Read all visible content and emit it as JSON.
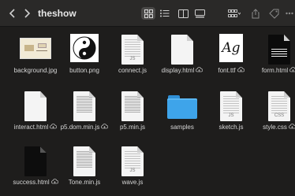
{
  "window": {
    "title": "theshow"
  },
  "toolbar": {
    "icons": [
      "chevron-left-icon",
      "chevron-right-icon",
      "grid-view-icon",
      "list-view-icon",
      "column-view-icon",
      "gallery-view-icon",
      "group-icon",
      "share-icon",
      "tag-icon",
      "more-icon"
    ]
  },
  "files": [
    {
      "name": "background.jpg",
      "kind": "image-background",
      "cloud": false
    },
    {
      "name": "button.png",
      "kind": "image-button",
      "cloud": false
    },
    {
      "name": "connect.js",
      "kind": "doc-js",
      "cloud": false
    },
    {
      "name": "display.html",
      "kind": "doc-plain",
      "cloud": true
    },
    {
      "name": "font.ttf",
      "kind": "image-font",
      "cloud": true
    },
    {
      "name": "form.html",
      "kind": "doc-form",
      "cloud": true
    },
    {
      "name": "interact.html",
      "kind": "doc-plain",
      "cloud": true
    },
    {
      "name": "p5.dom.min.js",
      "kind": "doc-dense",
      "cloud": true
    },
    {
      "name": "p5.min.js",
      "kind": "doc-dense",
      "cloud": false
    },
    {
      "name": "samples",
      "kind": "folder",
      "cloud": false
    },
    {
      "name": "sketch.js",
      "kind": "doc-js",
      "cloud": false
    },
    {
      "name": "style.css",
      "kind": "doc-css",
      "cloud": true
    },
    {
      "name": "success.html",
      "kind": "doc-black",
      "cloud": true
    },
    {
      "name": "Tone.min.js",
      "kind": "doc-dense",
      "cloud": false
    },
    {
      "name": "wave.js",
      "kind": "doc-js",
      "cloud": false
    }
  ],
  "extensions": {
    "js": "JS",
    "css": "CSS"
  },
  "colors": {
    "background": "#1e1d1c",
    "toolbar": "#2a2928",
    "folder": "#3ea4ea"
  }
}
